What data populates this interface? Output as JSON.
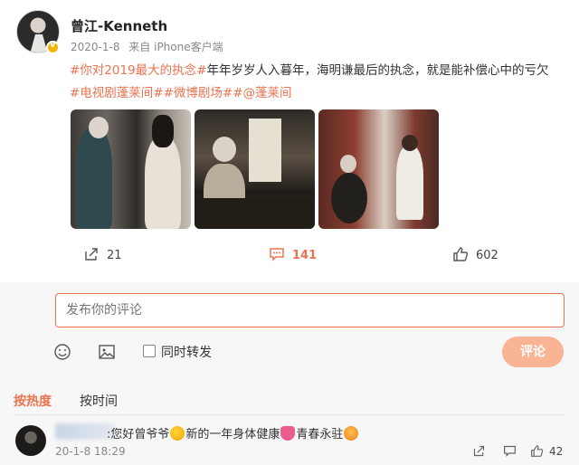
{
  "post": {
    "username": "曾江-Kenneth",
    "date": "2020-1-8",
    "source": "来自 iPhone客户端",
    "line1_tag": "#你对2019最大的执念#",
    "line1_text": "年年岁岁人入暮年，海明谦最后的执念，就是能补偿心中的亏欠",
    "line2_tag1": "#电视剧蓬莱间#",
    "line2_tag2": "#微博剧场#",
    "line2_tag3": "#@蓬莱间",
    "photos": [
      "photo-1",
      "photo-2",
      "photo-3"
    ]
  },
  "actions": {
    "share_count": "21",
    "comment_count": "141",
    "like_count": "602"
  },
  "composer": {
    "placeholder": "发布你的评论",
    "repost_label": "同时转发",
    "submit_label": "评论"
  },
  "sort": {
    "hot_label": "按热度",
    "time_label": "按时间"
  },
  "comment": {
    "text_part1": ":您好曾爷爷",
    "text_part2": "新的一年身体健康",
    "text_part3": "青春永驻",
    "date": "20-1-8 18:29",
    "likes": "42"
  },
  "colors": {
    "accent": "#eb7350",
    "submit_disabled": "#f8b493",
    "meta_gray": "#888888"
  }
}
